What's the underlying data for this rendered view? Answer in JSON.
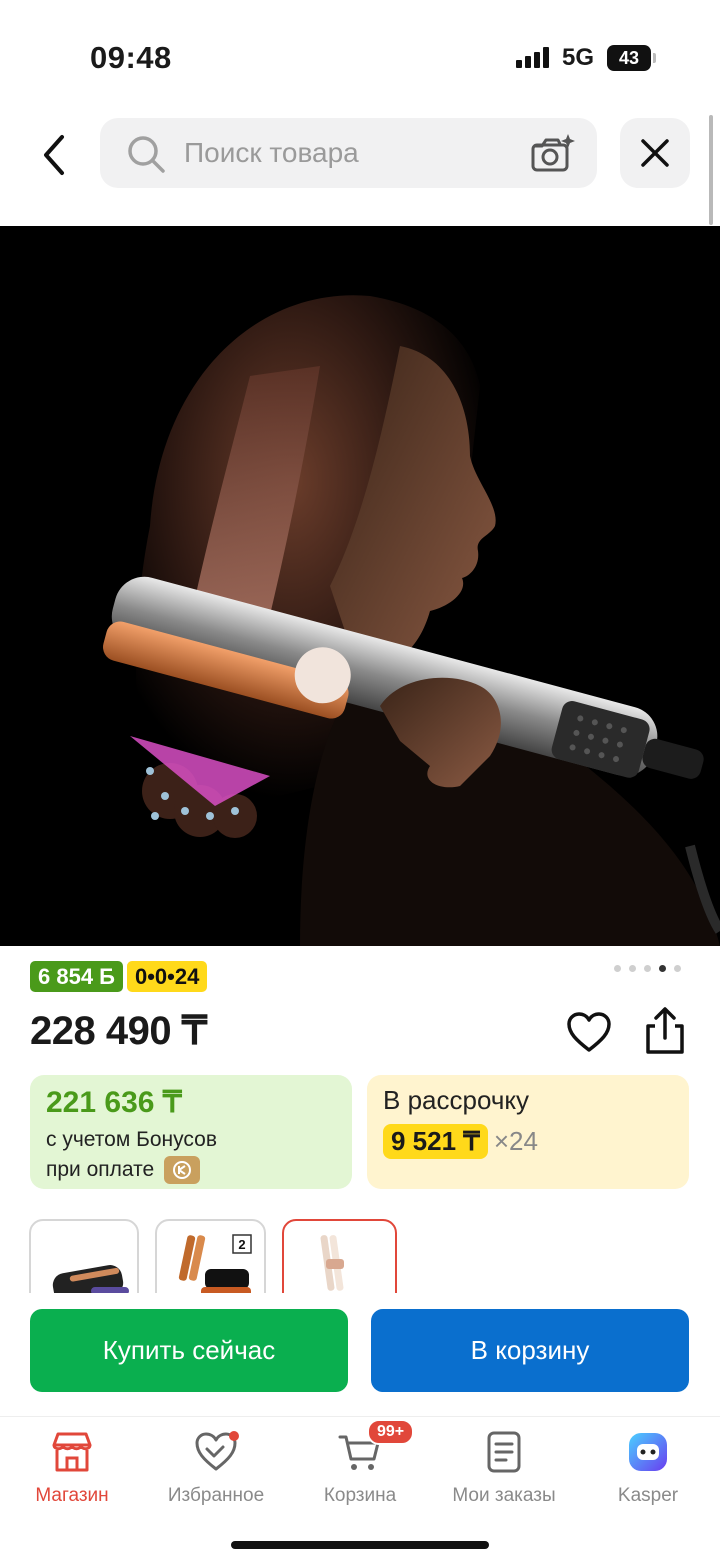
{
  "status_bar": {
    "time": "09:48",
    "network": "5G",
    "battery": "43"
  },
  "search": {
    "placeholder": "Поиск товара"
  },
  "product": {
    "bonus_badge": "6 854 Б",
    "installment_badge": "0•0•24",
    "gallery": {
      "count": 5,
      "active_index": 3
    },
    "price": "228 490 ₸",
    "bonus_card": {
      "amount": "221 636 ₸",
      "line1": "с учетом Бонусов",
      "line2": "при оплате"
    },
    "installment_card": {
      "title": "В рассрочку",
      "monthly": "9 521 ₸",
      "multiplier": "×24"
    },
    "variants": [
      {
        "name": "case-variant",
        "selected": false
      },
      {
        "name": "copper-variant",
        "badge": "2",
        "selected": false
      },
      {
        "name": "pink-variant",
        "selected": true
      }
    ]
  },
  "actions": {
    "buy_now": "Купить сейчас",
    "add_to_cart": "В корзину"
  },
  "tabbar": {
    "items": [
      {
        "label": "Магазин",
        "icon": "store-icon",
        "active": true
      },
      {
        "label": "Избранное",
        "icon": "heart-icon"
      },
      {
        "label": "Корзина",
        "icon": "cart-icon",
        "badge": "99+"
      },
      {
        "label": "Мои заказы",
        "icon": "orders-icon"
      },
      {
        "label": "Kasper",
        "icon": "kasper-assistant-icon"
      }
    ]
  },
  "colors": {
    "accent_red": "#e1473a",
    "buy_green": "#0aaf4f",
    "cart_blue": "#0a6fce",
    "bonus_green": "#4a9a1a",
    "installment_yellow": "#ffd91a"
  }
}
